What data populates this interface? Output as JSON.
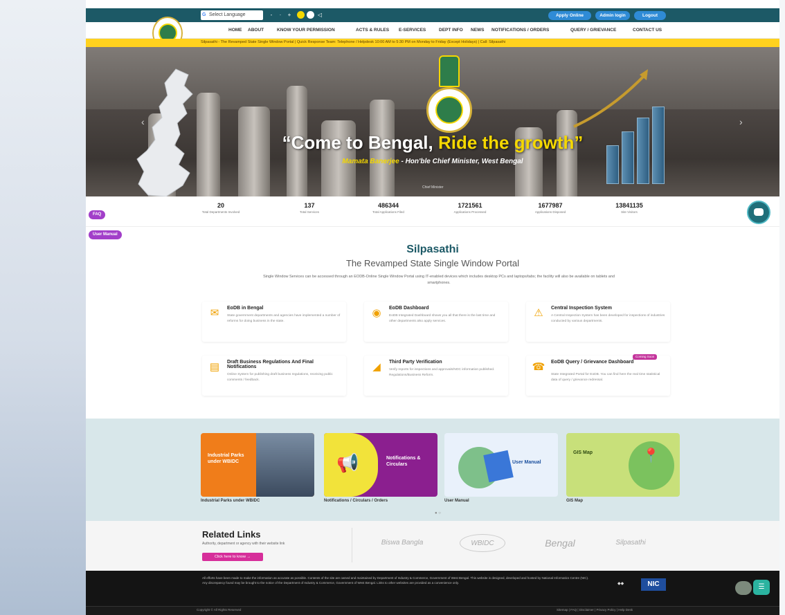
{
  "header": {
    "language_select": "Select Language",
    "buttons": {
      "apply_online": "Apply Online",
      "admin_login": "Admin login",
      "logout": "Logout"
    },
    "nav": [
      "HOME",
      "ABOUT",
      "KNOW YOUR PERMISSION",
      "ACTS & RULES",
      "E-SERVICES",
      "DEPT INFO",
      "NEWS",
      "NOTIFICATIONS / ORDERS",
      "QUERY / GRIEVANCE",
      "CONTACT US"
    ],
    "ticker": "Silpasathi - The Revamped State Single Window Portal | Quick Response Team: Telephone / Helpdesk 10:00 AM to 5:30 PM on Monday to Friday (Except Holidays) | Call: Silpasathi"
  },
  "hero": {
    "quote_part1": "“Come to Bengal, ",
    "quote_part2": "Ride the growth”",
    "name": "Mamata Banerjee",
    "designation": " - Hon'ble Chief Minister, West Bengal",
    "caption": "Chief Minister"
  },
  "stats": [
    {
      "num": "20",
      "label": "Total Departments Involved"
    },
    {
      "num": "137",
      "label": "Total Services"
    },
    {
      "num": "486344",
      "label": "Total Applications Filed"
    },
    {
      "num": "1721561",
      "label": "Applications Processed"
    },
    {
      "num": "1677987",
      "label": "Applications Disposed"
    },
    {
      "num": "13841135",
      "label": "Site Visitors"
    }
  ],
  "side_pills": {
    "faq": "FAQ",
    "user_manual": "User Manual"
  },
  "portal": {
    "title": "Silpasathi",
    "subtitle": "The Revamped State Single Window Portal",
    "description": "Single Window Services can be accessed through an EODB-Online Single Window Portal using IT-enabled devices which includes desktop PCs and laptops/tabs; the facility will also be available on tablets and smartphones."
  },
  "cards": [
    {
      "title": "EoDB in Bengal",
      "text": "State government departments and agencies have implemented a number of reforms for doing business in the state."
    },
    {
      "title": "EoDB Dashboard",
      "text": "EoDB Integrated Dashboard shows you all that there is the last time and other departments also apply services."
    },
    {
      "title": "Central Inspection System",
      "text": "A Central Inspection System has been developed for inspections of industries conducted by various departments."
    },
    {
      "title": "Draft Business Regulations And Final Notifications",
      "text": "Online System for publishing draft business regulations, receiving public comments / feedback."
    },
    {
      "title": "Third Party Verification",
      "text": "Verify reports for inspections and approvals/NOC information published. Regulations/Business Reform."
    },
    {
      "title": "EoDB Query / Grievance Dashboard",
      "text": "State Integrated Portal for EoDB. You can find here the real time statistical data of query / grievance redressal."
    }
  ],
  "card_badge": "Coming Soon",
  "tiles": [
    {
      "label": "Industrial Parks under WBIDC",
      "inner": "Industrial Parks under WBIDC"
    },
    {
      "label": "Notifications / Circulars / Orders",
      "inner": "Notifications & Circulars"
    },
    {
      "label": "User Manual",
      "inner": "User Manual"
    },
    {
      "label": "GIS Map",
      "inner": "GIS Map"
    }
  ],
  "related": {
    "title": "Related Links",
    "subtitle": "Authority, department or agency with their website link",
    "button": "Click here to know →",
    "partners": [
      "Biswa Bangla",
      "WBIDC",
      "Bengal",
      "Silpasathi"
    ]
  },
  "footer": {
    "text": "All efforts have been made to make the information as accurate as possible. Contents of the site are owned and maintained by Department of Industry & Commerce, Government of West Bengal. This website is designed, developed and hosted by National Informatics Centre (NIC). Any discrepancy found may be brought to the notice of the Department of Industry & Commerce, Government of West Bengal. Links to other websites are provided as a convenience only.",
    "nic_label": "NIC",
    "copyright": "Copyright © All Rights Reserved",
    "links": "Sitemap | FAQ | Disclaimer | Privacy Policy | Help Desk"
  },
  "colors": {
    "teal": "#1c5966",
    "yellow": "#ffd21e",
    "pill": "#a23fc9",
    "pink_button": "#d62e9a"
  }
}
